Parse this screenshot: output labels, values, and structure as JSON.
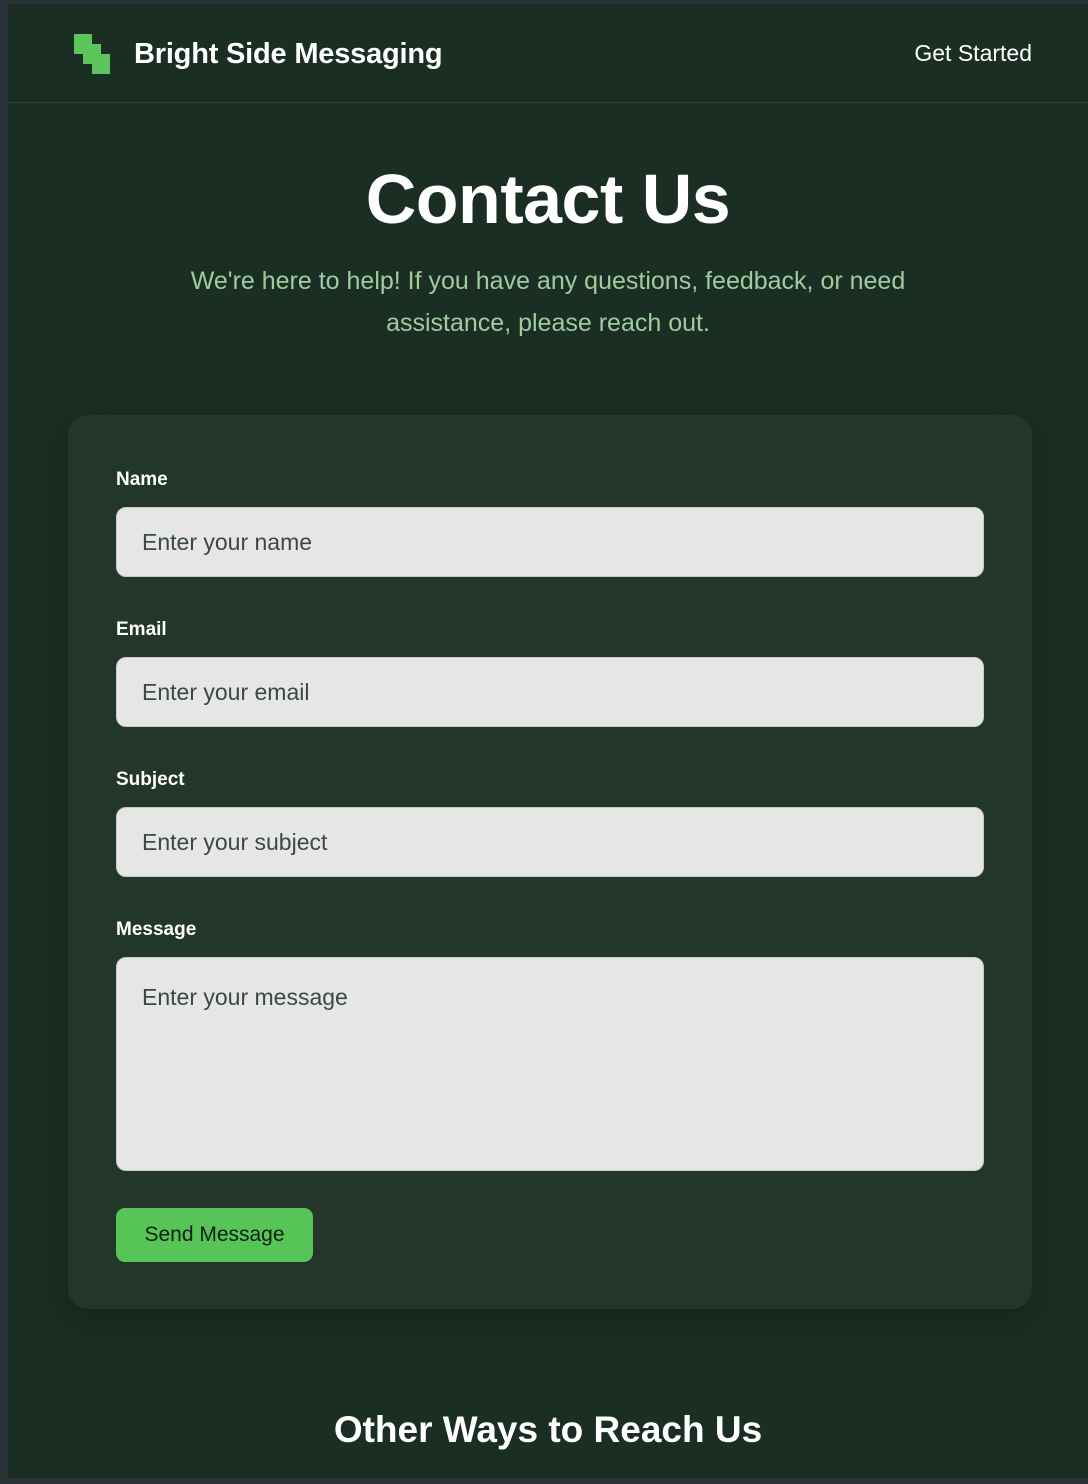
{
  "header": {
    "brand": "Bright Side Messaging",
    "nav_link": "Get Started",
    "logo_icon": "stacked-squares-logo",
    "accent_color": "#5cc45c"
  },
  "hero": {
    "title": "Contact Us",
    "subtitle": "We're here to help! If you have any questions, feedback, or need assistance, please reach out."
  },
  "form": {
    "name_label": "Name",
    "name_placeholder": "Enter your name",
    "email_label": "Email",
    "email_placeholder": "Enter your email",
    "subject_label": "Subject",
    "subject_placeholder": "Enter your subject",
    "message_label": "Message",
    "message_placeholder": "Enter your message",
    "submit_label": "Send Message"
  },
  "other": {
    "heading": "Other Ways to Reach Us"
  },
  "colors": {
    "background": "#1b2e23",
    "card": "#22372a",
    "subtitle": "#9fcc9f",
    "button": "#57c457"
  }
}
